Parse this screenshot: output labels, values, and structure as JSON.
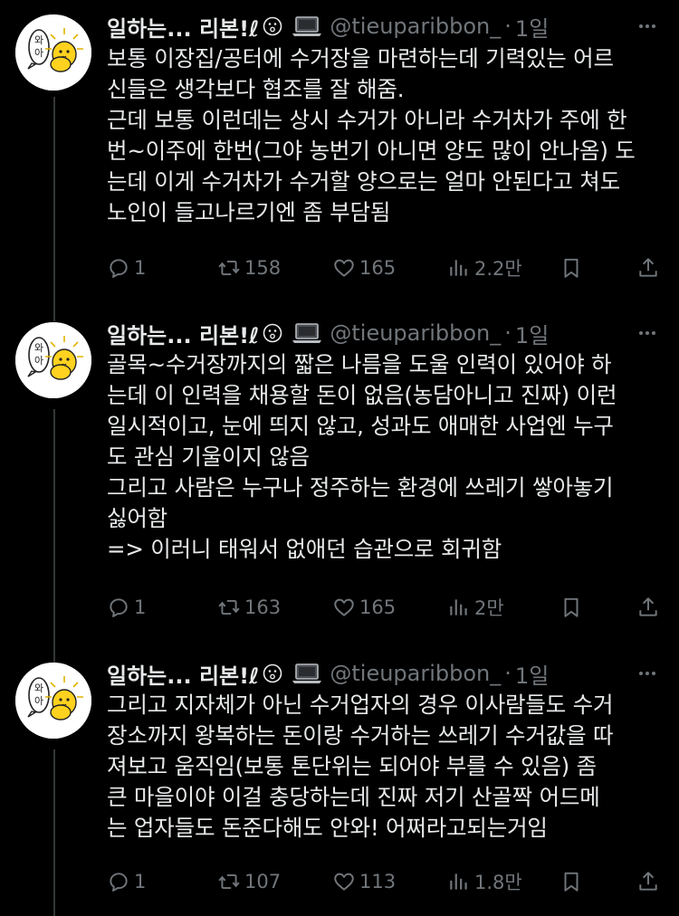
{
  "tweets": [
    {
      "display_name": "일하는... 리본!ℓ",
      "handle": "@tieuparibbon_",
      "separator": "·",
      "time": "1일",
      "lines": [
        "보통 이장집/공터에 수거장을 마련하는데 기력있는 어르",
        "신들은 생각보다 협조를 잘 해줌.",
        "근데 보통 이런데는 상시 수거가 아니라 수거차가 주에 한",
        "번~이주에 한번(그야 농번기 아니면 양도 많이 안나옴) 도",
        "는데 이게 수거차가 수거할 양으로는 얼마 안된다고 쳐도",
        "노인이 들고나르기엔 좀 부담됨"
      ],
      "replies": "1",
      "reposts": "158",
      "likes": "165",
      "views": "2.2만"
    },
    {
      "display_name": "일하는... 리본!ℓ",
      "handle": "@tieuparibbon_",
      "separator": "·",
      "time": "1일",
      "lines": [
        "골목~수거장까지의 짧은 나름을 도울 인력이 있어야 하",
        "는데 이 인력을 채용할 돈이 없음(농담아니고 진짜) 이런",
        "일시적이고, 눈에 띄지 않고, 성과도 애매한 사업엔 누구",
        "도 관심 기울이지 않음",
        "그리고 사람은 누구나 정주하는 환경에 쓰레기 쌓아놓기",
        "싫어함",
        "=> 이러니 태워서 없애던 습관으로 회귀함"
      ],
      "replies": "1",
      "reposts": "163",
      "likes": "165",
      "views": "2만"
    },
    {
      "display_name": "일하는... 리본!ℓ",
      "handle": "@tieuparibbon_",
      "separator": "·",
      "time": "1일",
      "lines": [
        "그리고 지자체가 아닌 수거업자의 경우 이사람들도 수거",
        "장소까지 왕복하는 돈이랑 수거하는 쓰레기 수거값을 따",
        "져보고 움직임(보통 톤단위는 되어야 부를 수 있음) 좀",
        "큰 마을이야 이걸 충당하는데 진짜 저기 산골짝 어드메",
        "는 업자들도 돈준다해도 안와! 어쩌라고되는거임"
      ],
      "replies": "1",
      "reposts": "107",
      "likes": "113",
      "views": "1.8만"
    }
  ],
  "avatar_text": "와아",
  "colors": {
    "background": "#000000",
    "text": "#e7e9ea",
    "secondary": "#71767b",
    "divider": "#333639"
  },
  "icons": {
    "reply": "reply-icon",
    "repost": "repost-icon",
    "like": "like-icon",
    "views": "views-icon",
    "bookmark": "bookmark-icon",
    "share": "share-icon",
    "more": "more-icon"
  }
}
